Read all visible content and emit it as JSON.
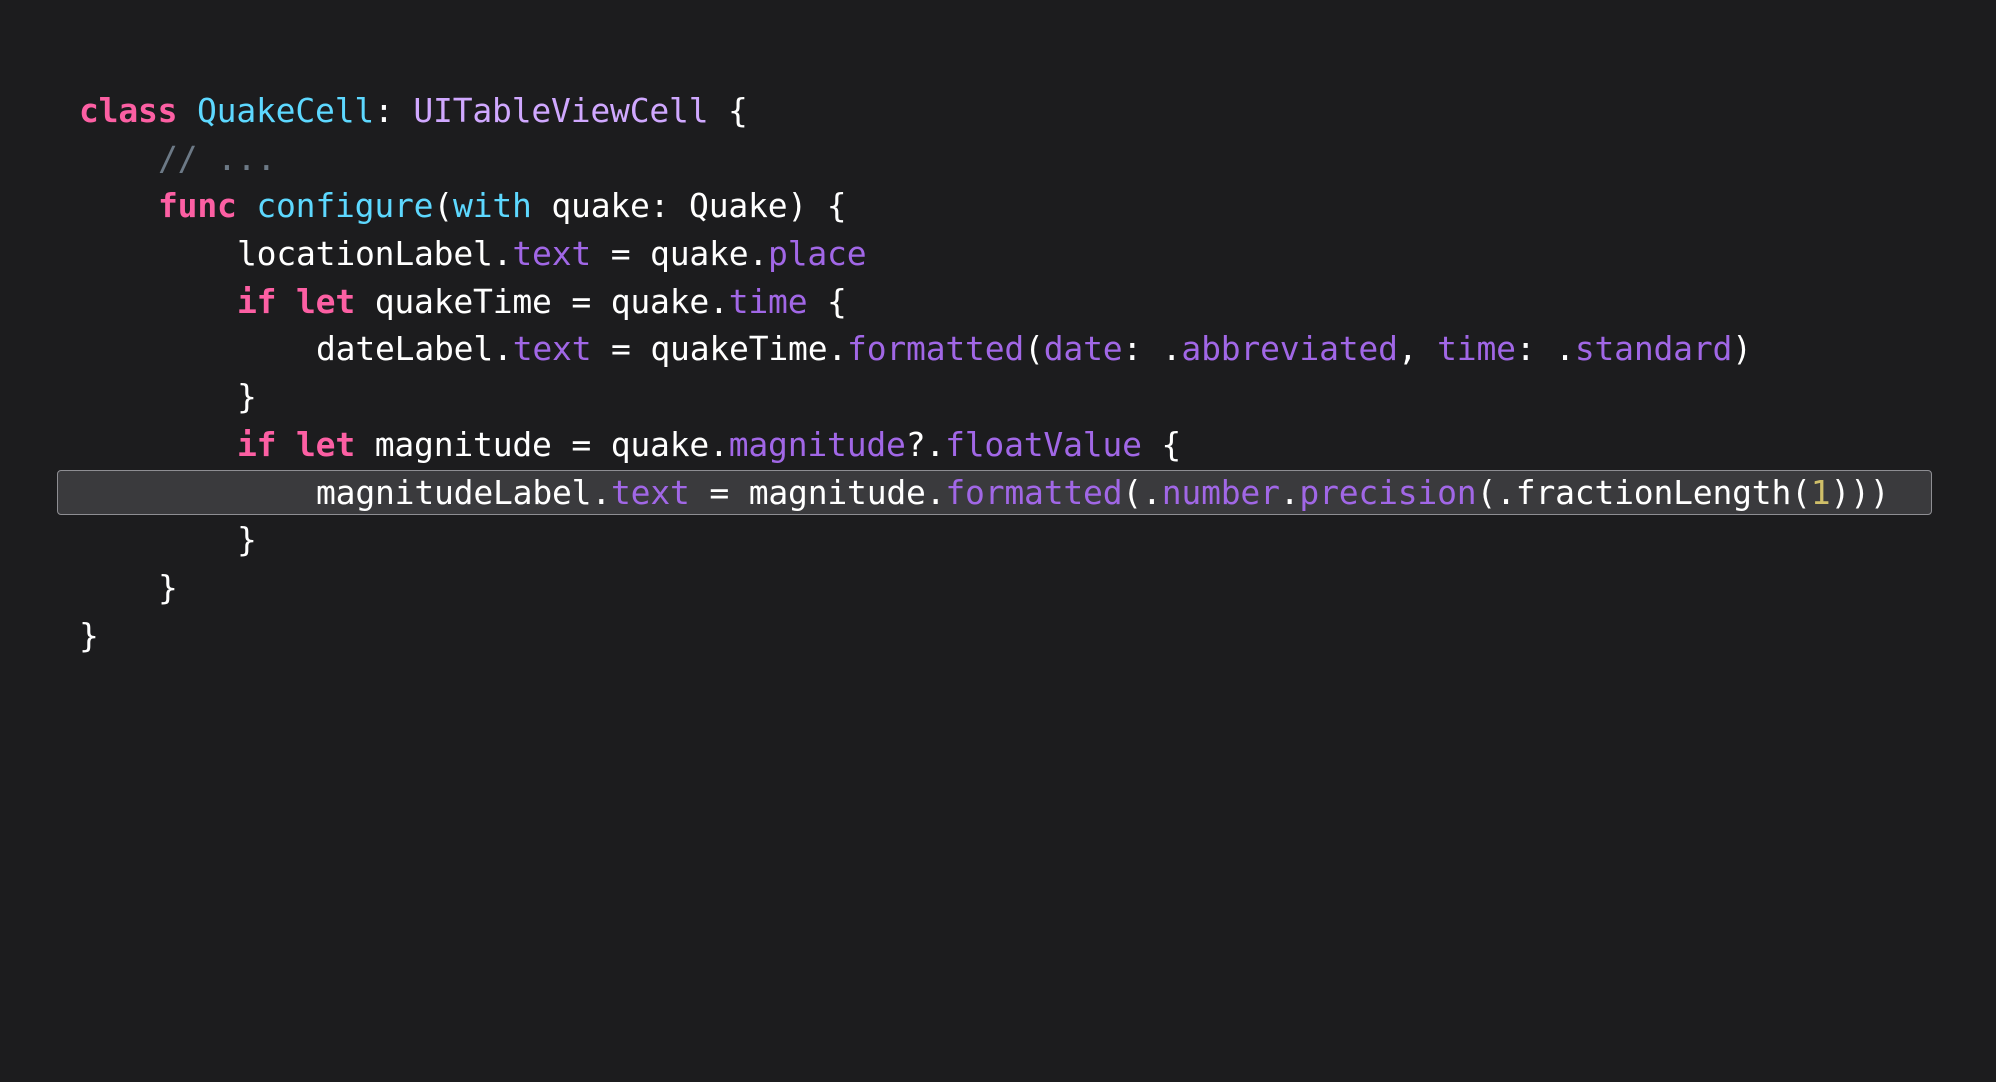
{
  "editor": {
    "background": "#1c1c1e",
    "highlighted_line_index": 8,
    "colors": {
      "keyword": "#fc5fa3",
      "type_declaration": "#5dd8ff",
      "type_reference": "#d0a8ff",
      "property": "#a167e6",
      "comment": "#6c7986",
      "number": "#d0bf69",
      "plain": "#ffffff"
    },
    "lines": [
      {
        "indent": 0,
        "tokens": [
          {
            "t": "class",
            "c": "kw"
          },
          {
            "t": " ",
            "c": "pl"
          },
          {
            "t": "QuakeCell",
            "c": "ty"
          },
          {
            "t": ": ",
            "c": "pl"
          },
          {
            "t": "UITableViewCell",
            "c": "cls"
          },
          {
            "t": " {",
            "c": "pl"
          }
        ]
      },
      {
        "indent": 1,
        "tokens": [
          {
            "t": "// ...",
            "c": "cm"
          }
        ]
      },
      {
        "indent": 1,
        "tokens": [
          {
            "t": "func",
            "c": "kw"
          },
          {
            "t": " ",
            "c": "pl"
          },
          {
            "t": "configure",
            "c": "ty"
          },
          {
            "t": "(",
            "c": "pl"
          },
          {
            "t": "with",
            "c": "ty"
          },
          {
            "t": " quake: Quake) {",
            "c": "pl"
          }
        ]
      },
      {
        "indent": 2,
        "tokens": [
          {
            "t": "locationLabel.",
            "c": "pl"
          },
          {
            "t": "text",
            "c": "prop"
          },
          {
            "t": " = quake.",
            "c": "pl"
          },
          {
            "t": "place",
            "c": "prop"
          }
        ]
      },
      {
        "indent": 2,
        "tokens": [
          {
            "t": "if",
            "c": "kw"
          },
          {
            "t": " ",
            "c": "pl"
          },
          {
            "t": "let",
            "c": "kw"
          },
          {
            "t": " quakeTime = quake.",
            "c": "pl"
          },
          {
            "t": "time",
            "c": "prop"
          },
          {
            "t": " {",
            "c": "pl"
          }
        ]
      },
      {
        "indent": 3,
        "tokens": [
          {
            "t": "dateLabel.",
            "c": "pl"
          },
          {
            "t": "text",
            "c": "prop"
          },
          {
            "t": " = quakeTime.",
            "c": "pl"
          },
          {
            "t": "formatted",
            "c": "prop"
          },
          {
            "t": "(",
            "c": "pl"
          },
          {
            "t": "date",
            "c": "prop"
          },
          {
            "t": ": .",
            "c": "pl"
          },
          {
            "t": "abbreviated",
            "c": "prop"
          },
          {
            "t": ", ",
            "c": "pl"
          },
          {
            "t": "time",
            "c": "prop"
          },
          {
            "t": ": .",
            "c": "pl"
          },
          {
            "t": "standard",
            "c": "prop"
          },
          {
            "t": ")",
            "c": "pl"
          }
        ]
      },
      {
        "indent": 2,
        "tokens": [
          {
            "t": "}",
            "c": "pl"
          }
        ]
      },
      {
        "indent": 2,
        "tokens": [
          {
            "t": "if",
            "c": "kw"
          },
          {
            "t": " ",
            "c": "pl"
          },
          {
            "t": "let",
            "c": "kw"
          },
          {
            "t": " magnitude = quake.",
            "c": "pl"
          },
          {
            "t": "magnitude",
            "c": "prop"
          },
          {
            "t": "?.",
            "c": "pl"
          },
          {
            "t": "floatValue",
            "c": "prop"
          },
          {
            "t": " {",
            "c": "pl"
          }
        ]
      },
      {
        "indent": 3,
        "tokens": [
          {
            "t": "magnitudeLabel.",
            "c": "pl"
          },
          {
            "t": "text",
            "c": "prop"
          },
          {
            "t": " = magnitude.",
            "c": "pl"
          },
          {
            "t": "formatted",
            "c": "prop"
          },
          {
            "t": "(.",
            "c": "pl"
          },
          {
            "t": "number",
            "c": "prop"
          },
          {
            "t": ".",
            "c": "pl"
          },
          {
            "t": "precision",
            "c": "prop"
          },
          {
            "t": "(.fractionLength(",
            "c": "pl"
          },
          {
            "t": "1",
            "c": "num"
          },
          {
            "t": ")))",
            "c": "pl"
          }
        ]
      },
      {
        "indent": 2,
        "tokens": [
          {
            "t": "}",
            "c": "pl"
          }
        ]
      },
      {
        "indent": 1,
        "tokens": [
          {
            "t": "}",
            "c": "pl"
          }
        ]
      },
      {
        "indent": 0,
        "tokens": [
          {
            "t": "}",
            "c": "pl"
          }
        ]
      }
    ]
  }
}
